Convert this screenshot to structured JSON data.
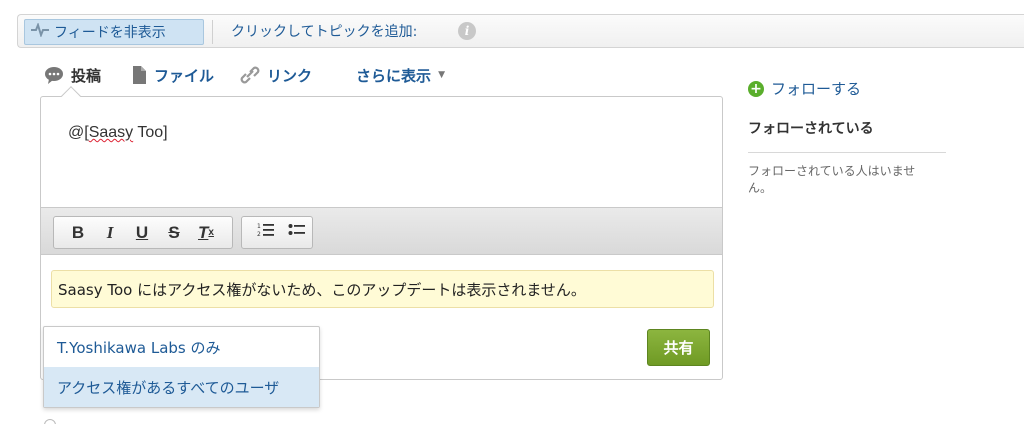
{
  "topbar": {
    "hide_feed_label": "フィードを非表示",
    "add_topic_label": "クリックしてトピックを追加:",
    "info_icon": "info-icon"
  },
  "tabs": {
    "post": "投稿",
    "file": "ファイル",
    "link": "リンク",
    "more": "さらに表示"
  },
  "composer": {
    "text_prefix": "@[",
    "text_mention": "Saasy",
    "text_suffix": " Too]",
    "notice": "Saasy Too にはアクセス権がないため、このアップデートは表示されません。",
    "share_label": "共有",
    "share_color": "#7aa531",
    "toolbar": {
      "bold": "B",
      "italic": "I",
      "underline": "U",
      "strike": "S",
      "clear": "T"
    }
  },
  "visibility_dropdown": {
    "options": [
      "T.Yoshikawa Labs のみ",
      "アクセス権があるすべてのユーザ"
    ],
    "selected_index": 1
  },
  "sidebar": {
    "follow_label": "フォローする",
    "followers_title": "フォローされている",
    "no_followers": "フォローされている人はいません。"
  }
}
